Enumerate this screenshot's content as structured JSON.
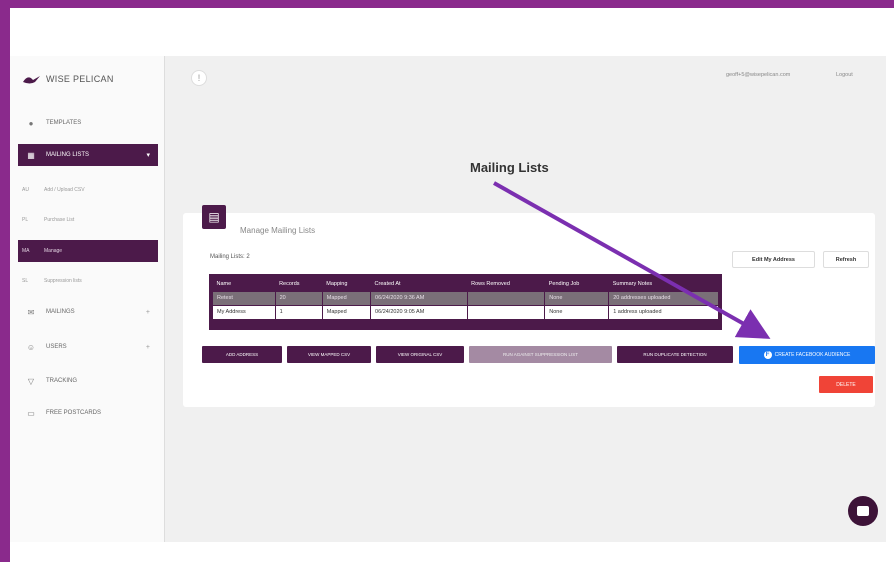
{
  "brand": {
    "name": "WISE PELICAN"
  },
  "sidebar": {
    "items": [
      {
        "label": "TEMPLATES",
        "icon": "palette-icon"
      },
      {
        "label": "MAILING LISTS",
        "icon": "grid-icon",
        "active": true
      },
      {
        "label": "MAILINGS",
        "icon": "envelope-icon"
      },
      {
        "label": "USERS",
        "icon": "users-icon"
      },
      {
        "label": "TRACKING",
        "icon": "filter-icon"
      },
      {
        "label": "FREE POSTCARDS",
        "icon": "card-icon"
      }
    ],
    "sub_items": [
      {
        "abbr": "AU",
        "label": "Add / Upload CSV"
      },
      {
        "abbr": "PL",
        "label": "Purchase List"
      },
      {
        "abbr": "MA",
        "label": "Manage",
        "active": true
      },
      {
        "abbr": "SL",
        "label": "Suppression lists"
      }
    ]
  },
  "topbar": {
    "badge": "!",
    "email": "geoff+5@wisepelican.com",
    "logout": "Logout"
  },
  "main": {
    "title": "Mailing Lists",
    "card_title": "Manage Mailing Lists",
    "list_count": "Mailing Lists: 2",
    "edit_address": "Edit My Address",
    "refresh": "Refresh",
    "table": {
      "headers": [
        "Name",
        "Records",
        "Mapping",
        "Created At",
        "Rows Removed",
        "Pending Job",
        "Summary Notes"
      ],
      "rows": [
        [
          "Retest",
          "20",
          "Mapped",
          "06/24/2020 9:36 AM",
          "",
          "None",
          "20 addresses uploaded"
        ],
        [
          "My Address",
          "1",
          "Mapped",
          "06/24/2020 9:05 AM",
          "",
          "None",
          "1 address uploaded"
        ]
      ]
    },
    "actions": [
      {
        "label": "ADD ADDRESS"
      },
      {
        "label": "VIEW MAPPED CSV"
      },
      {
        "label": "VIEW ORIGINAL CSV"
      },
      {
        "label": "RUN AGAINST SUPPRESSION LIST",
        "disabled": true
      },
      {
        "label": "RUN DUPLICATE DETECTION"
      }
    ],
    "facebook_label": "CREATE FACEBOOK AUDIENCE",
    "delete_label": "DELETE"
  },
  "colors": {
    "frame": "#8a2a8c",
    "accent": "#4c1a4a",
    "facebook": "#1877f2",
    "danger": "#f04437",
    "annotation_arrow": "#7b2fb0"
  }
}
